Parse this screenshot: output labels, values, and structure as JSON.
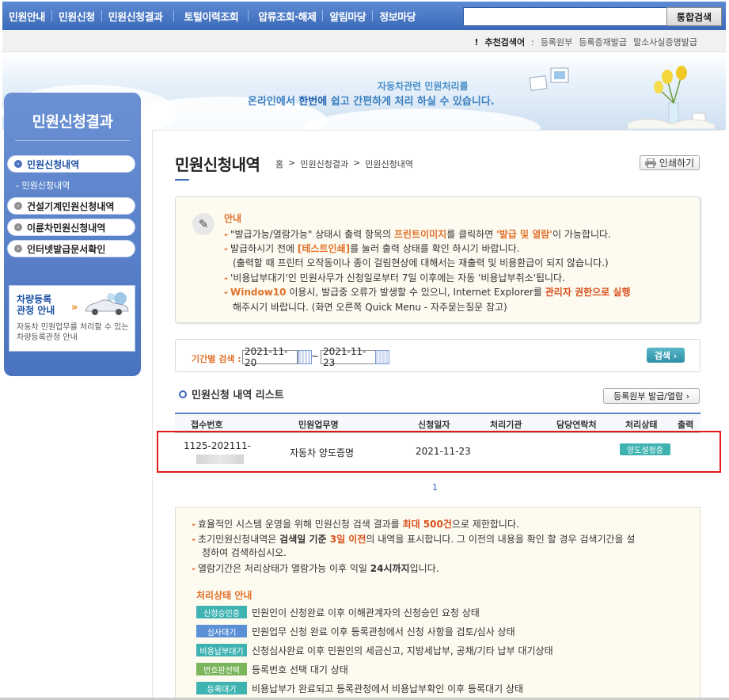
{
  "nav": {
    "items": [
      "민원안내",
      "민원신청",
      "민원신청결과",
      "토털이력조회",
      "압류조회·해제",
      "알림마당",
      "정보마당"
    ],
    "search_button": "통합검색",
    "search_value": ""
  },
  "recommend": {
    "prefix": "!",
    "label": "추천검색어",
    "colon": ":",
    "items": [
      "등록원부",
      "등록증재발급",
      "말소사실증명발급"
    ]
  },
  "banner": {
    "line1": "자동차관련 민원처리를",
    "line2_a": "온라인에서 ",
    "line2_b": "한번에",
    "line2_c": " 쉽고 간편하게 처리 하실 수 있습니다."
  },
  "sidebar": {
    "title": "민원신청결과",
    "items": [
      {
        "label": "민원신청내역",
        "active": true
      },
      {
        "label": "건설기계민원신청내역",
        "active": false
      },
      {
        "label": "이륜차민원신청내역",
        "active": false
      },
      {
        "label": "인터넷발급문서확인",
        "active": false
      }
    ],
    "sub_item": "- 민원신청내역",
    "card": {
      "title_line1": "차량등록",
      "title_line2": "관청 안내",
      "arrow": "»",
      "desc_line1": "자동차 민원업무를 처리할 수 있는",
      "desc_line2": "차량등록관청 안내"
    }
  },
  "main": {
    "title": "민원신청내역",
    "breadcrumb": [
      "홈",
      ">",
      "민원신청결과",
      ">",
      "민원신청내역"
    ],
    "print_label": "인쇄하기"
  },
  "notice": {
    "title": "안내",
    "line1_a": "\"발급가능/열람가능\" 상태시 출력 항목의 ",
    "line1_b": "프린트이미지",
    "line1_c": "를 클릭하면 ",
    "line1_d": "'발급 및 열람'",
    "line1_e": "이 가능합니다.",
    "line2_a": "발급하시기 전에 ",
    "line2_b": "[테스트인쇄]",
    "line2_c": "를 눌러 출력 상태를 확인 하시기 바랍니다.",
    "line3": "(출력할 때 프린터 오작동이나 종이 걸림현상에 대해서는 재출력 및 비용환급이 되지 않습니다.)",
    "line4": "'비용납부대기'인 민원사무가 신청일로부터 7일 이후에는 자동 '비용납부취소'됩니다.",
    "line5_a": "Window10",
    "line5_b": " 이용시, 발급중 오류가 발생할 수 있으니, Internet Explorer를 ",
    "line5_c": "관리자 권한으로 실행",
    "line6": "해주시기 바랍니다. (화면 오른쪽 Quick Menu - 자주묻는질문 참고)"
  },
  "period": {
    "label": "기간별 검색 :",
    "from": "2021-11-20",
    "tilde": "~",
    "to": "2021-11-23",
    "search_label": "검색 ›"
  },
  "list": {
    "title": "민원신청 내역 리스트",
    "register_button": "등록원부 발급/열람  ›",
    "headers": [
      "접수번호",
      "민원업무명",
      "신청일자",
      "처리기관",
      "담당연락처",
      "처리상태",
      "출력"
    ],
    "rows": [
      {
        "receipt_no": "1125-202111-",
        "task": "자동차 양도증명",
        "date": "2021-11-23",
        "agency": "",
        "contact": "",
        "status": "양도설정중",
        "output": ""
      }
    ],
    "page": "1"
  },
  "info": {
    "line1_a": "효율적인 시스템 운영을 위해 민원신청 검색 결과를 ",
    "line1_b": "최대 500건",
    "line1_c": "으로 제한합니다.",
    "line2_a": "초기민원신청내역은 ",
    "line2_b": "검색일 기준 ",
    "line2_c": "3일 이전",
    "line2_d": "의 내역을 표시합니다. 그 이전의 내용을 확인 할 경우 검색기간을 설",
    "line3": "정하여 검색하십시오.",
    "line4_a": "열람기간은 처리상태가 열람가능 이후 익일 ",
    "line4_b": "24시까지",
    "line4_c": "입니다.",
    "status_title": "처리상태 안내",
    "statuses": [
      {
        "badge": "신청승인중",
        "desc": "민원인이 신청완료 이후 이해관계자의 신청승인 요청 상태",
        "color": "#3fb3b2"
      },
      {
        "badge": "심사대기",
        "desc": "민원업무 신청 완료 이후 등록관청에서 신청 사항을 검토/심사 상태",
        "color": "#5b8fd6"
      },
      {
        "badge": "비용납부대기",
        "desc": "신청심사완료 이후 민원인의 세금신고, 지방세납부, 공채/기타 납부 대기상태",
        "color": "#3fb3b2"
      },
      {
        "badge": "번호판선택",
        "desc": "등록번호 선택 대기 상태",
        "color": "#7ab55c"
      },
      {
        "badge": "등록대기",
        "desc": "비용납부가 완료되고 등록관청에서 비용납부확인 이후 등록대기 상태",
        "color": "#3fb3b2"
      }
    ]
  }
}
